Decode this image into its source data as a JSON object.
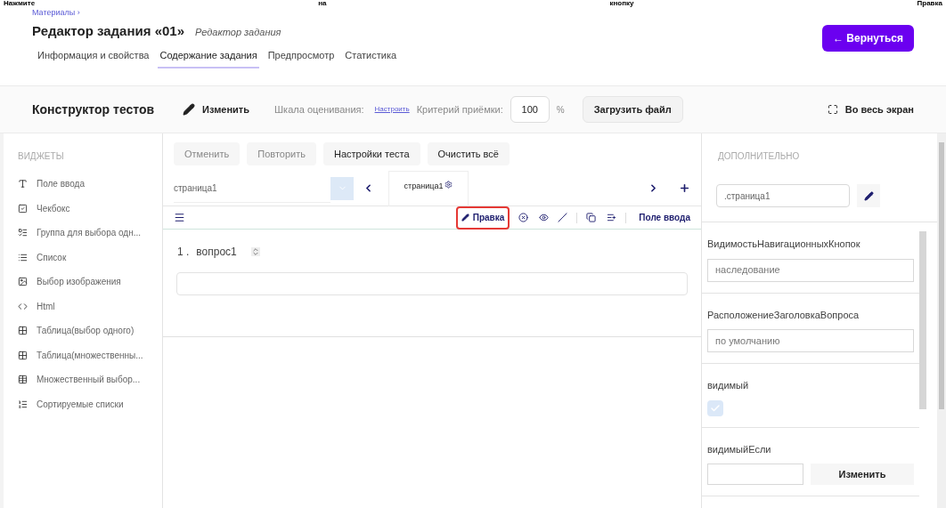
{
  "instruction": [
    "Нажмите",
    "на",
    "кнопку",
    "Правка"
  ],
  "breadcrumb": "Материалы ›",
  "title": "Редактор задания «01»",
  "subtitle": "Редактор задания",
  "back_button": "← Вернуться",
  "tabs": [
    {
      "label": "Информация и свойства",
      "selected": false
    },
    {
      "label": "Содержание задания",
      "selected": true
    },
    {
      "label": "Предпросмотр",
      "selected": false
    },
    {
      "label": "Статистика",
      "selected": false
    }
  ],
  "toolbar": {
    "title": "Конструктор тестов",
    "edit": "Изменить",
    "scale_label": "Шкала оценивания:",
    "scale_link": "Настроить",
    "criterion_label": "Критерий приёмки:",
    "criterion_value": "100",
    "percent": "%",
    "upload": "Загрузить файл",
    "fullscreen": "Во весь экран"
  },
  "sidebar": {
    "heading": "ВИДЖЕТЫ",
    "items": [
      {
        "label": "Поле ввода",
        "kind": "text"
      },
      {
        "label": "Чекбокс",
        "kind": "checkbox"
      },
      {
        "label": "Группа для выбора одн...",
        "kind": "radio"
      },
      {
        "label": "Список",
        "kind": "dropdown"
      },
      {
        "label": "Выбор изображения",
        "kind": "image"
      },
      {
        "label": "Html",
        "kind": "html"
      },
      {
        "label": "Таблица(выбор одного)",
        "kind": "matrix"
      },
      {
        "label": "Таблица(множественны...",
        "kind": "matrix"
      },
      {
        "label": "Множественный выбор...",
        "kind": "multi"
      },
      {
        "label": "Сортируемые списки",
        "kind": "sort"
      }
    ]
  },
  "editor": {
    "actions": [
      {
        "label": "Отменить",
        "disabled": true
      },
      {
        "label": "Повторить",
        "disabled": true
      },
      {
        "label": "Настройки теста",
        "disabled": false
      },
      {
        "label": "Очистить всё",
        "disabled": false
      }
    ],
    "page_select": "страница1",
    "page_tab": "страница1",
    "edit_button": "Правка",
    "question_type": "Поле ввода",
    "question_number": "1 .",
    "question_title": "вопрос1"
  },
  "properties": {
    "heading": "ДОПОЛНИТЕЛЬНО",
    "object_name": ".страница1",
    "items": [
      {
        "label": "ВидимостьНавигационныхКнопок",
        "kind": "select",
        "value": "наследование"
      },
      {
        "label": "РасположениеЗаголовкаВопроса",
        "kind": "select",
        "value": "по умолчанию"
      },
      {
        "label": "видимый",
        "kind": "checkbox",
        "checked": true
      },
      {
        "label": "видимыйЕсли",
        "kind": "condition",
        "button": "Изменить"
      }
    ]
  }
}
